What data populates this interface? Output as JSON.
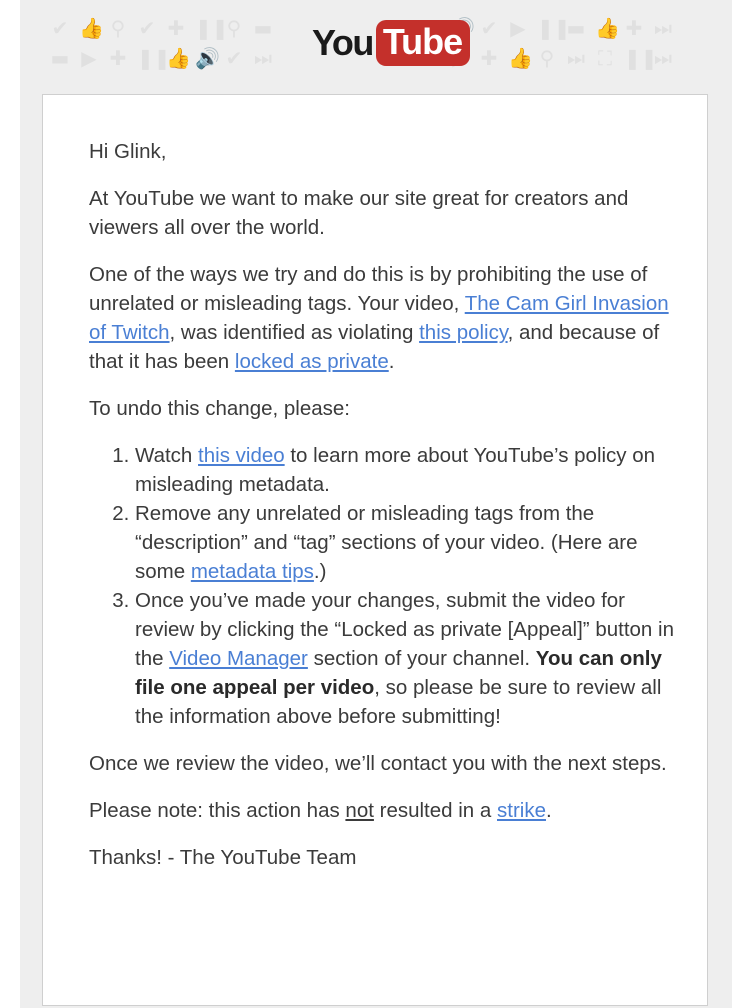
{
  "header": {
    "logo_you": "You",
    "logo_tube": "Tube",
    "pattern_icons": [
      "check-icon",
      "thumbs-up-icon",
      "search-icon",
      "check-icon",
      "plus-icon",
      "pause-icon",
      "search-icon",
      "comment-icon",
      "volume-icon",
      "check-icon",
      "play-icon",
      "pause-icon",
      "comment-icon",
      "thumbs-up-icon",
      "plus-icon",
      "next-icon"
    ]
  },
  "email": {
    "greeting": "Hi Glink,",
    "para1": "At YouTube we want to make our site great for creators and viewers all over the world.",
    "para2": {
      "t1": "One of the ways we try and do this is by prohibiting the use of unrelated or misleading tags. Your video, ",
      "video_link": "The Cam Girl Invasion of Twitch",
      "t2": ", was identified as violating ",
      "policy_link": "this policy",
      "t3": ", and because of that it has been ",
      "locked_link": "locked as private",
      "t4": "."
    },
    "para3": "To undo this change, please:",
    "steps": {
      "s1_a": "Watch ",
      "s1_link": "this video",
      "s1_b": " to learn more about YouTube’s policy on misleading metadata.",
      "s2_a": "Remove any unrelated or misleading tags from the “description” and “tag” sections of your video. (Here are some ",
      "s2_link": "metadata tips",
      "s2_b": ".)",
      "s3_a": "Once you’ve made your changes, submit the video for review by clicking the “Locked as private [Appeal]” button in the ",
      "s3_link": "Video Manager",
      "s3_b": " section of your channel. ",
      "s3_bold": "You can only file one appeal per video",
      "s3_c": ", so please be sure to review all the information above before submitting!"
    },
    "para4": "Once we review the video, we’ll contact you with the next steps.",
    "para5": {
      "t1": "Please note: this action has ",
      "not": "not",
      "t2": " resulted in a ",
      "strike_link": "strike",
      "t3": "."
    },
    "signoff": "Thanks! - The YouTube Team"
  }
}
